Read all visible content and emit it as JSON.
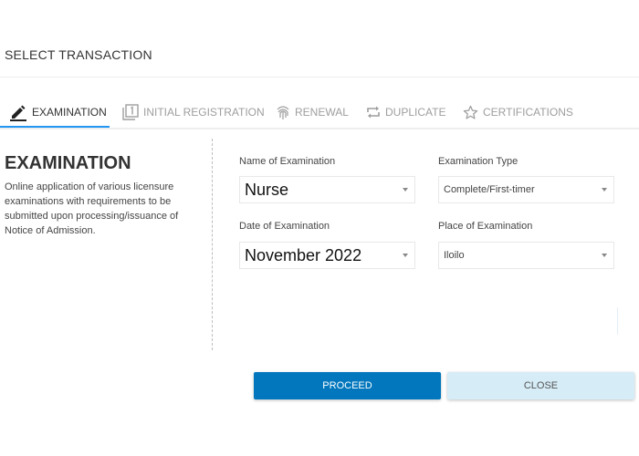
{
  "dialog": {
    "title": "SELECT TRANSACTION"
  },
  "tabs": [
    {
      "label": "EXAMINATION",
      "icon": "pencil-icon",
      "active": true
    },
    {
      "label": "INITIAL REGISTRATION",
      "icon": "filter-1-icon",
      "active": false
    },
    {
      "label": "RENEWAL",
      "icon": "fingerprint-icon",
      "active": false
    },
    {
      "label": "DUPLICATE",
      "icon": "repeat-icon",
      "active": false
    },
    {
      "label": "CERTIFICATIONS",
      "icon": "star-outline-icon",
      "active": false
    }
  ],
  "section": {
    "heading": "EXAMINATION",
    "description": "Online application of various licensure examinations with requirements to be submitted upon processing/issuance of Notice of Admission."
  },
  "form": {
    "name_of_examination": {
      "label": "Name of Examination",
      "value": "Nurse"
    },
    "examination_type": {
      "label": "Examination Type",
      "value": "Complete/First-timer"
    },
    "date_of_examination": {
      "label": "Date of Examination",
      "value": "November 2022"
    },
    "place_of_examination": {
      "label": "Place of Examination",
      "value": "Iloilo"
    }
  },
  "actions": {
    "proceed_label": "PROCEED",
    "close_label": "CLOSE"
  },
  "colors": {
    "accent": "#2196f3",
    "primary_button": "#0277bd",
    "secondary_button": "#d6ecf7"
  }
}
